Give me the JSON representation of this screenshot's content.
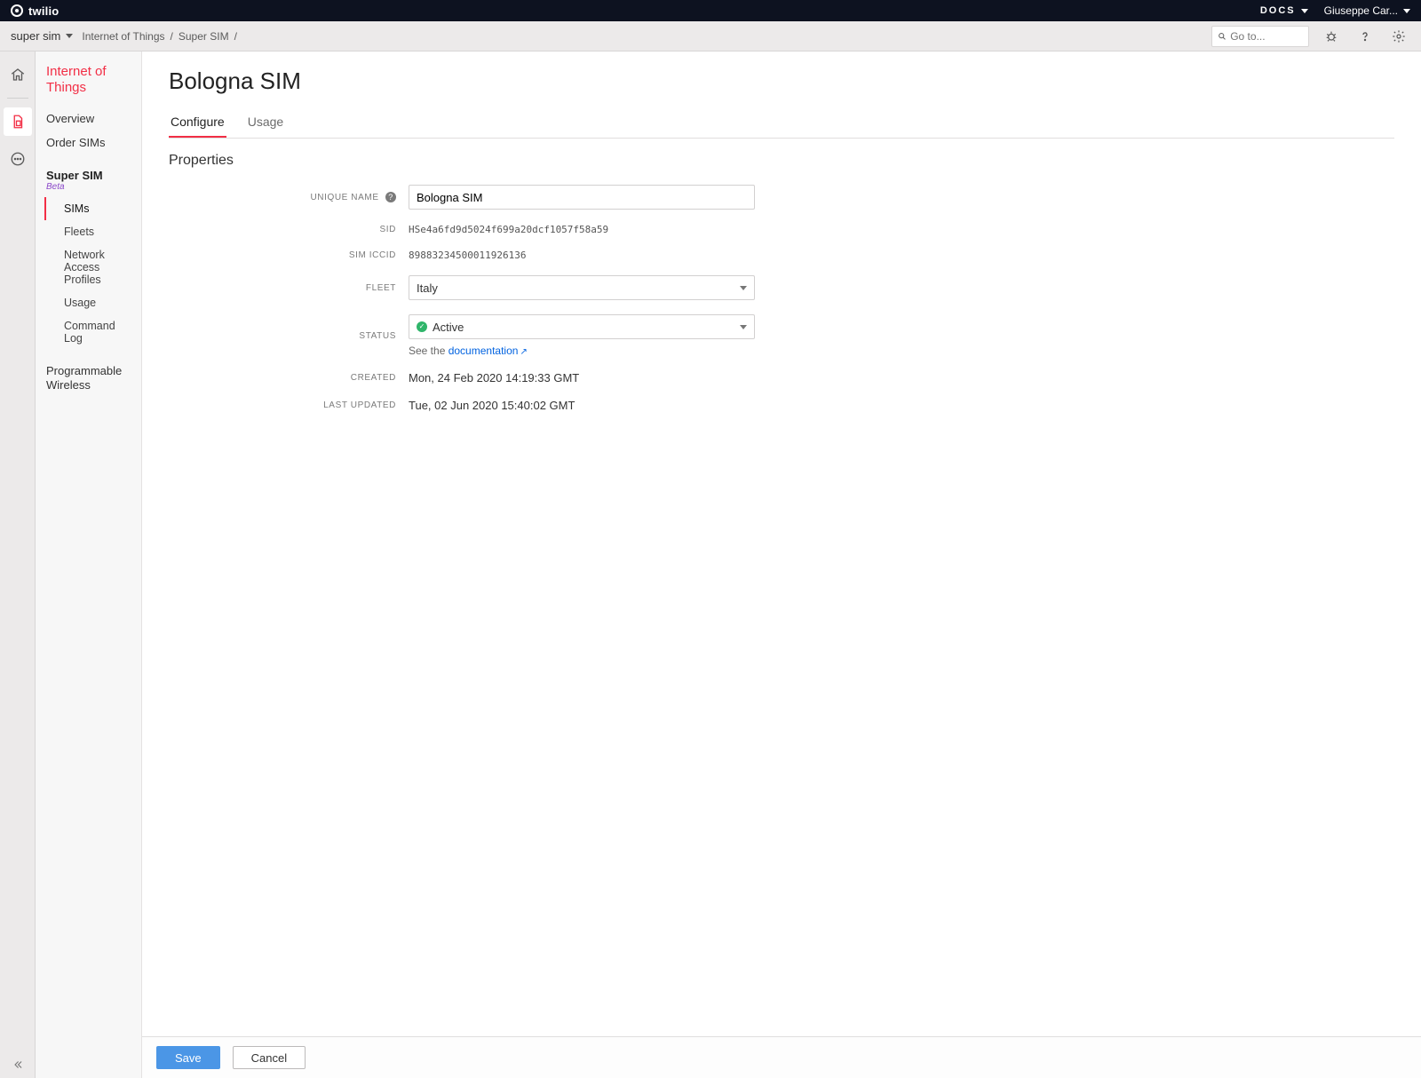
{
  "topbar": {
    "brand": "twilio",
    "docs_label": "DOCS",
    "user_label": "Giuseppe Car..."
  },
  "subbar": {
    "account_label": "super sim",
    "crumb1": "Internet of Things",
    "crumb2": "Super SIM",
    "search_placeholder": "Go to..."
  },
  "sidenav": {
    "title_line1": "Internet of",
    "title_line2": "Things",
    "overview": "Overview",
    "order_sims": "Order SIMs",
    "super_sim": "Super SIM",
    "beta": "Beta",
    "sub_sims": "SIMs",
    "sub_fleets": "Fleets",
    "sub_nap": "Network Access Profiles",
    "sub_usage": "Usage",
    "sub_cmdlog": "Command Log",
    "prog_wireless_l1": "Programmable",
    "prog_wireless_l2": "Wireless"
  },
  "page": {
    "title": "Bologna SIM",
    "tab_configure": "Configure",
    "tab_usage": "Usage",
    "section_properties": "Properties"
  },
  "form": {
    "unique_name_label": "UNIQUE NAME",
    "unique_name_value": "Bologna SIM",
    "sid_label": "SID",
    "sid_value": "HSe4a6fd9d5024f699a20dcf1057f58a59",
    "iccid_label": "SIM ICCID",
    "iccid_value": "89883234500011926136",
    "fleet_label": "FLEET",
    "fleet_value": "Italy",
    "status_label": "STATUS",
    "status_value": "Active",
    "doc_prefix": "See the ",
    "doc_link": "documentation",
    "created_label": "CREATED",
    "created_value": "Mon, 24 Feb 2020 14:19:33 GMT",
    "updated_label": "LAST UPDATED",
    "updated_value": "Tue, 02 Jun 2020 15:40:02 GMT"
  },
  "footer": {
    "save": "Save",
    "cancel": "Cancel"
  }
}
